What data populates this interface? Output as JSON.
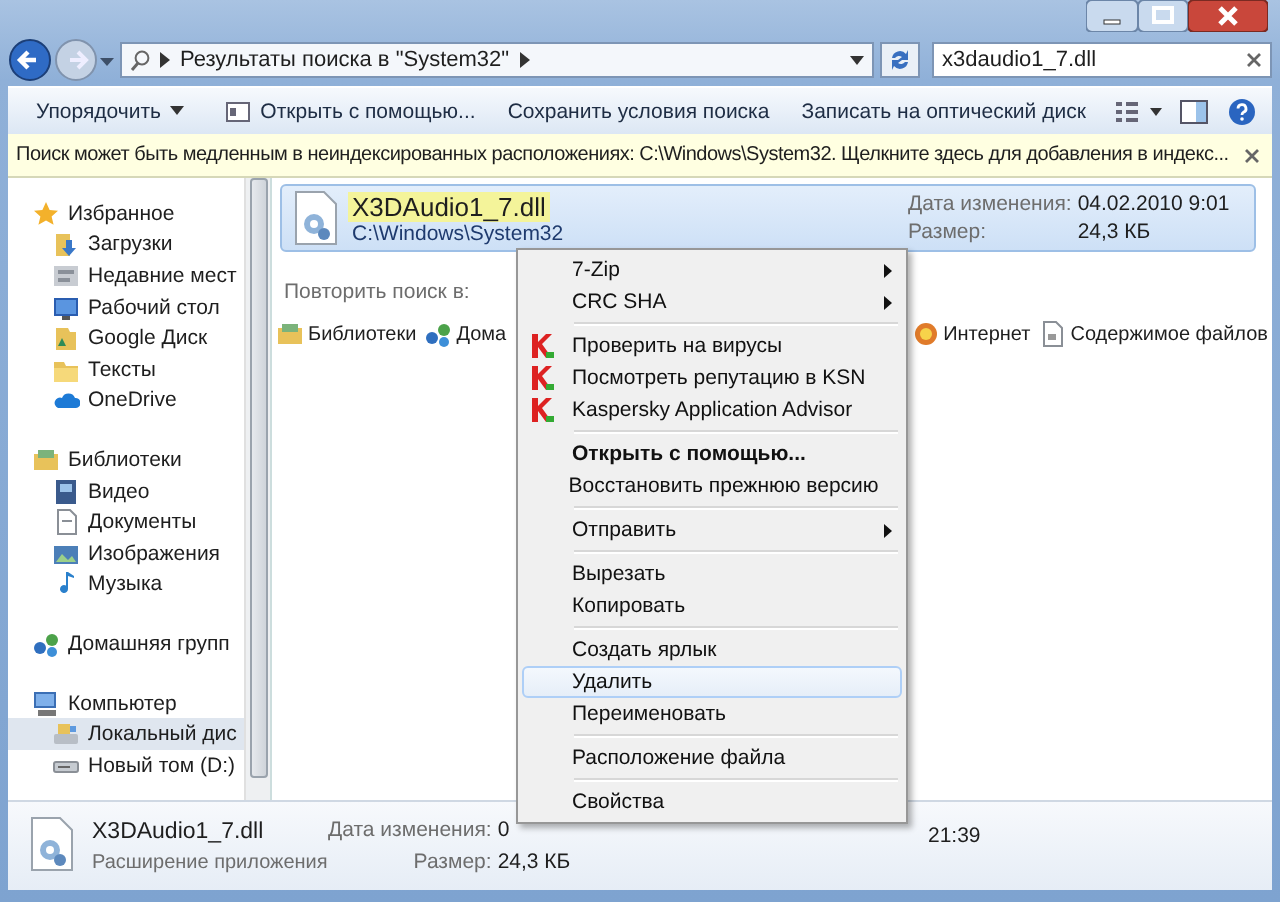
{
  "address_bar": {
    "breadcrumb": "Результаты поиска в \"System32\"",
    "search": {
      "value": "x3daudio1_7.dll"
    }
  },
  "toolbar": {
    "buttons": [
      {
        "label": "Упорядочить",
        "dropdown": true
      },
      {
        "label": "Открыть с помощью...",
        "dropdown": false
      },
      {
        "label": "Сохранить условия поиска",
        "dropdown": false
      },
      {
        "label": "Записать на оптический диск",
        "dropdown": false
      }
    ]
  },
  "info_bar": {
    "text": "Поиск может быть медленным в неиндексированных расположениях: C:\\Windows\\System32. Щелкните здесь для добавления в индекс..."
  },
  "sidebar": {
    "groups": [
      {
        "header": "Избранное",
        "items": [
          {
            "label": "Загрузки",
            "selected": false
          },
          {
            "label": "Недавние мест",
            "selected": false
          },
          {
            "label": "Рабочий стол",
            "selected": false
          },
          {
            "label": "Google Диск",
            "selected": false
          },
          {
            "label": "Тексты",
            "selected": false
          },
          {
            "label": "OneDrive",
            "selected": false
          }
        ]
      },
      {
        "header": "Библиотеки",
        "items": [
          {
            "label": "Видео",
            "selected": false
          },
          {
            "label": "Документы",
            "selected": false
          },
          {
            "label": "Изображения",
            "selected": false
          },
          {
            "label": "Музыка",
            "selected": false
          }
        ]
      },
      {
        "header": "Домашняя групп"
      },
      {
        "header": "Компьютер",
        "items": [
          {
            "label": "Локальный дис",
            "selected": true
          },
          {
            "label": "Новый том (D:)",
            "selected": false
          }
        ]
      }
    ]
  },
  "results": [
    {
      "name": "X3DAudio1_7.dll",
      "path": "C:\\Windows\\System32",
      "match_highlight": true,
      "selected": true,
      "date_label": "Дата изменения:",
      "date": "04.02.2010 9:01",
      "size_label": "Размер:",
      "size": "24,3 КБ"
    }
  ],
  "search_again": {
    "label": "Повторить поиск в:",
    "targets": [
      {
        "label": "Библиотеки"
      },
      {
        "label": "Дома"
      },
      {
        "label": "Интернет"
      },
      {
        "label": "Содержимое файлов"
      }
    ]
  },
  "menu": {
    "groups": [
      {
        "items": [
          {
            "label": "7-Zip",
            "kind": "plain",
            "submenu": true,
            "bold": false,
            "highlighted": false
          },
          {
            "label": "CRC SHA",
            "kind": "plain",
            "submenu": true,
            "bold": false,
            "highlighted": false
          }
        ]
      },
      {
        "items": [
          {
            "label": "Проверить на вирусы",
            "kind": "kaspersky",
            "submenu": false,
            "bold": false,
            "highlighted": false
          },
          {
            "label": "Посмотреть репутацию в KSN",
            "kind": "kaspersky",
            "submenu": false,
            "bold": false,
            "highlighted": false
          },
          {
            "label": "Kaspersky Application Advisor",
            "kind": "kaspersky",
            "submenu": false,
            "bold": false,
            "highlighted": false
          }
        ]
      },
      {
        "items": [
          {
            "label": "Открыть с помощью...",
            "kind": "plain",
            "submenu": false,
            "bold": true,
            "highlighted": false
          },
          {
            "label": "Восстановить прежнюю версию",
            "kind": "plain",
            "submenu": false,
            "bold": false,
            "highlighted": false
          }
        ]
      },
      {
        "items": [
          {
            "label": "Отправить",
            "kind": "plain",
            "submenu": true,
            "bold": false,
            "highlighted": false
          }
        ]
      },
      {
        "items": [
          {
            "label": "Вырезать",
            "kind": "plain",
            "submenu": false,
            "bold": false,
            "highlighted": false
          },
          {
            "label": "Копировать",
            "kind": "plain",
            "submenu": false,
            "bold": false,
            "highlighted": false
          }
        ]
      },
      {
        "items": [
          {
            "label": "Создать ярлык",
            "kind": "plain",
            "submenu": false,
            "bold": false,
            "highlighted": false
          },
          {
            "label": "Удалить",
            "kind": "plain",
            "submenu": false,
            "bold": false,
            "highlighted": true
          },
          {
            "label": "Переименовать",
            "kind": "plain",
            "submenu": false,
            "bold": false,
            "highlighted": false
          }
        ]
      },
      {
        "items": [
          {
            "label": "Расположение файла",
            "kind": "plain",
            "submenu": false,
            "bold": false,
            "highlighted": false
          }
        ]
      },
      {
        "items": [
          {
            "label": "Свойства",
            "kind": "plain",
            "submenu": false,
            "bold": false,
            "highlighted": false
          }
        ]
      }
    ]
  },
  "details": {
    "name": "X3DAudio1_7.dll",
    "type": "Расширение приложения",
    "fields": [
      {
        "label": "Дата изменения:",
        "value": "0"
      },
      {
        "label": "Размер:",
        "value": "24,3 КБ"
      }
    ],
    "column_3": "21:39"
  }
}
